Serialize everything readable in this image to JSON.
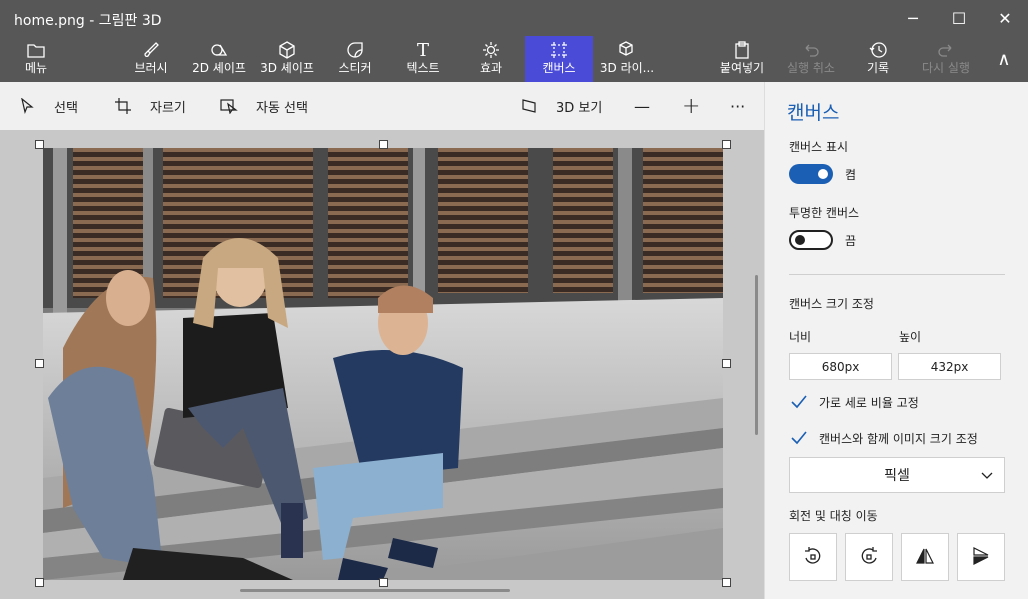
{
  "window": {
    "title": "home.png - 그림판 3D",
    "minimize_glyph": "─",
    "maximize_glyph": "☐",
    "close_glyph": "✕"
  },
  "ribbon": {
    "tabs": [
      {
        "label": "메뉴",
        "icon": "folder-icon"
      },
      {
        "label": "브러시",
        "icon": "brush-icon"
      },
      {
        "label": "2D 셰이프",
        "icon": "shapes-2d-icon"
      },
      {
        "label": "3D 셰이프",
        "icon": "cube-icon"
      },
      {
        "label": "스티커",
        "icon": "sticker-icon"
      },
      {
        "label": "텍스트",
        "icon": "text-icon"
      },
      {
        "label": "효과",
        "icon": "sun-icon"
      },
      {
        "label": "캔버스",
        "icon": "canvas-icon",
        "active": true
      },
      {
        "label": "3D 라이...",
        "icon": "library-3d-icon"
      }
    ],
    "actions": [
      {
        "label": "붙여넣기",
        "icon": "paste-icon"
      },
      {
        "label": "실행 취소",
        "icon": "undo-icon",
        "disabled": true
      },
      {
        "label": "기록",
        "icon": "history-icon"
      },
      {
        "label": "다시 실행",
        "icon": "redo-icon",
        "disabled": true
      }
    ],
    "collapse_glyph": "∧",
    "active_color": "#4a4bd6"
  },
  "toolbar": {
    "select_label": "선택",
    "crop_label": "자르기",
    "magic_select_label": "자동 선택",
    "view3d_label": "3D 보기",
    "zoom_out_glyph": "—",
    "zoom_in_glyph": "+",
    "more_glyph": "···"
  },
  "panel": {
    "title": "캔버스",
    "show_canvas_label": "캔버스 표시",
    "show_canvas_state": "켬",
    "transparent_label": "투명한 캔버스",
    "transparent_state": "끔",
    "resize_label": "캔버스 크기 조정",
    "width_label": "너비",
    "height_label": "높이",
    "width_value": "680px",
    "height_value": "432px",
    "lock_ratio_label": "가로 세로 비율 고정",
    "resize_image_label": "캔버스와 함께 이미지 크기 조정",
    "unit_value": "픽셀",
    "rotate_label": "회전 및 대칭 이동",
    "accent_color": "#1a5fb4"
  }
}
